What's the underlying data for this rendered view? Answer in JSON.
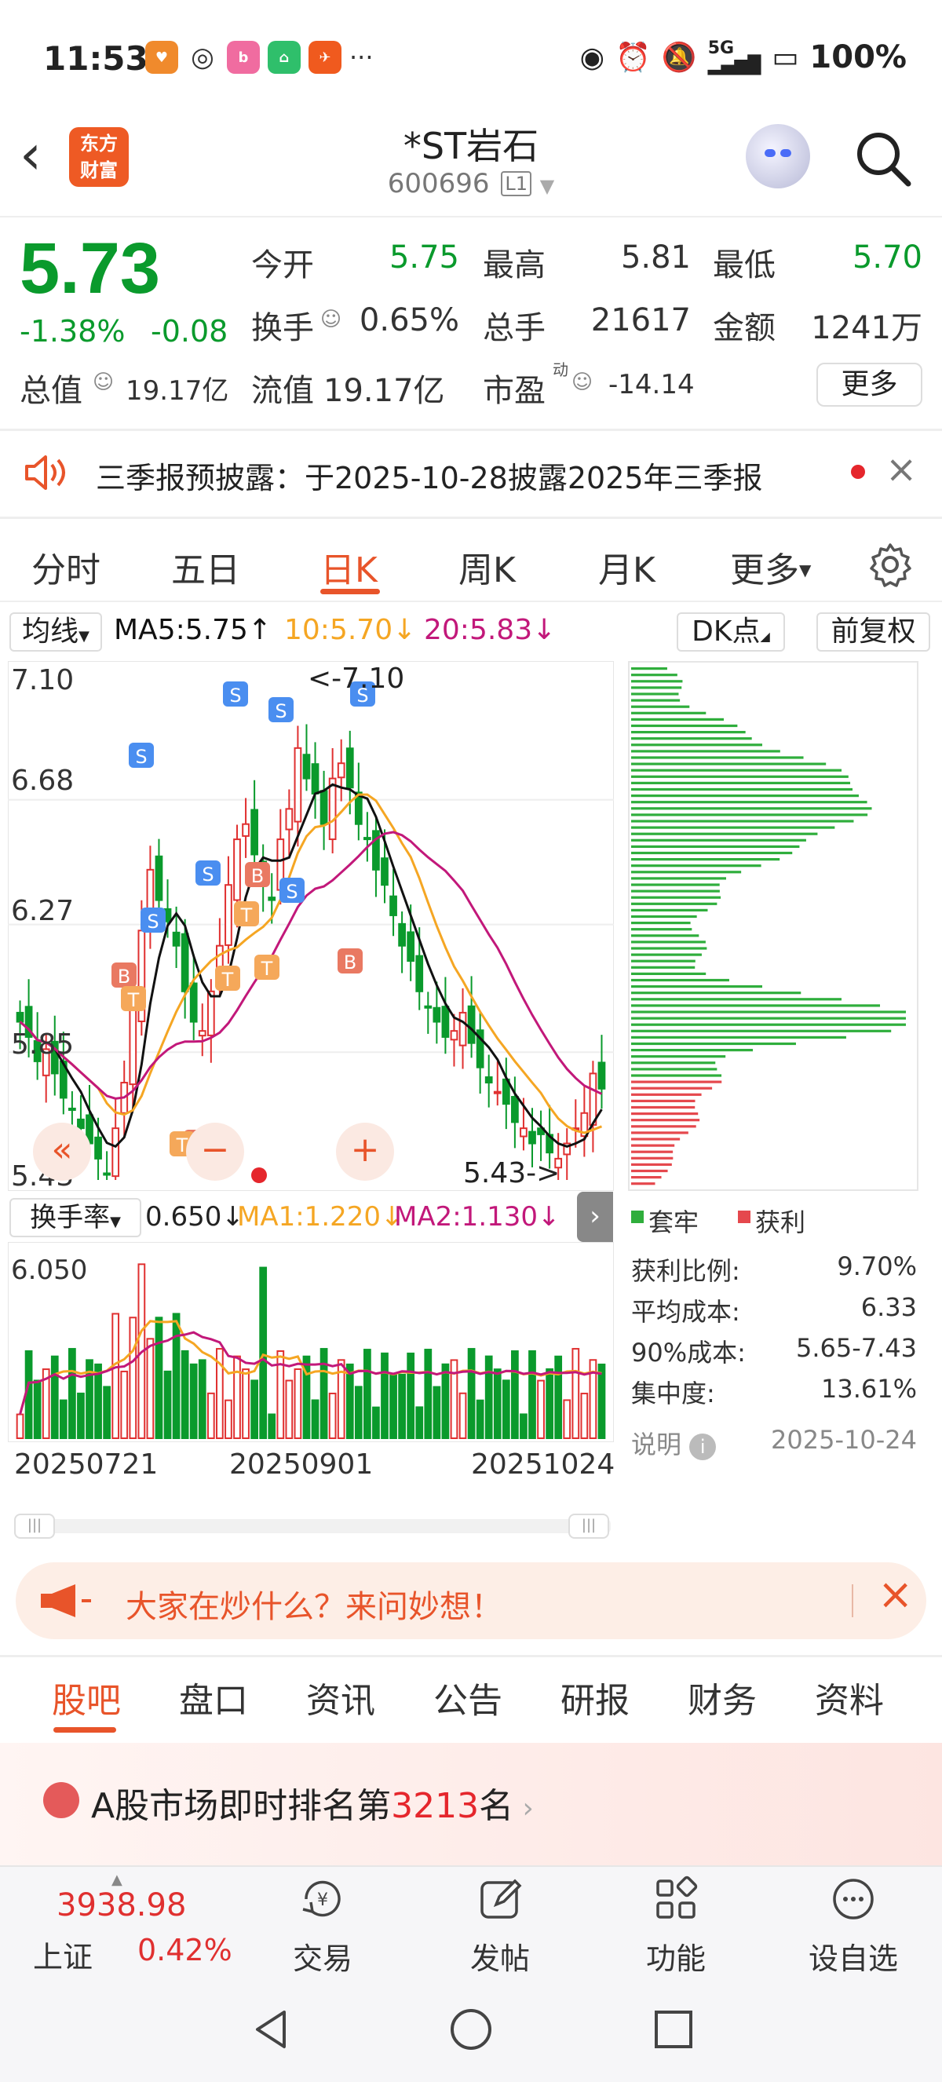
{
  "status_bar": {
    "time": "11:53",
    "battery": "100%",
    "signal": "5G"
  },
  "header": {
    "stock_name": "*ST岩石",
    "stock_code": "600696",
    "level_badge": "L1",
    "logo_line1": "东方",
    "logo_line2": "财富"
  },
  "quote": {
    "price": "5.73",
    "change_pct": "-1.38%",
    "change_abs": "-0.08",
    "open_label": "今开",
    "open": "5.75",
    "high_label": "最高",
    "high": "5.81",
    "low_label": "最低",
    "low": "5.70",
    "turnover_label": "换手",
    "turnover": "0.65%",
    "volume_label": "总手",
    "volume": "21617",
    "amount_label": "金额",
    "amount": "1241万",
    "mktcap_label": "总值",
    "mktcap": "19.17亿",
    "float_label": "流值",
    "float_cap": "19.17亿",
    "pe_label": "市盈",
    "pe_sup": "动",
    "pe": "-14.14",
    "more_label": "更多"
  },
  "notice": {
    "text": "三季报预披露：于2025-10-28披露2025年三季报"
  },
  "period_tabs": [
    "分时",
    "五日",
    "日K",
    "周K",
    "月K",
    "更多"
  ],
  "period_active": "日K",
  "chart_controls": {
    "ma_select": "均线",
    "ma5": "MA5:5.75↑",
    "ma10": "10:5.70↓",
    "ma20": "20:5.83↓",
    "dk_label": "DK点",
    "adjust_label": "前复权"
  },
  "price_labels": {
    "y1": "7.10",
    "y2": "6.68",
    "y3": "6.27",
    "y4": "5.85",
    "y5": "5.43",
    "max_mark": "<-7.10",
    "min_mark": "5.43->"
  },
  "turnover_indicator": {
    "select": "换手率",
    "value": "0.650↓",
    "ma1": "MA1:1.220↓",
    "ma2": "MA2:1.130↓",
    "ymax": "6.050"
  },
  "dates": [
    "20250721",
    "20250901",
    "20251024"
  ],
  "chip_dist": {
    "legend_trapped": "套牢",
    "legend_profit": "获利",
    "stats": [
      {
        "label": "获利比例:",
        "value": "9.70%"
      },
      {
        "label": "平均成本:",
        "value": "6.33"
      },
      {
        "label": "90%成本:",
        "value": "5.65-7.43"
      },
      {
        "label": "集中度:",
        "value": "13.61%"
      }
    ],
    "note_label": "说明",
    "date": "2025-10-24"
  },
  "promo": {
    "text": "大家在炒什么？来问妙想！"
  },
  "bottom_tabs": [
    "股吧",
    "盘口",
    "资讯",
    "公告",
    "研报",
    "财务",
    "资料"
  ],
  "bottom_tab_active": "股吧",
  "rank": {
    "prefix": "A股市场即时排名第",
    "number": "3213",
    "suffix": "名"
  },
  "index": {
    "value": "3938.98",
    "name": "上证",
    "change": "0.42%"
  },
  "nav": [
    "交易",
    "发帖",
    "功能",
    "设自选"
  ],
  "colors": {
    "up": "#e03030",
    "down": "#0a9a2c",
    "accent": "#e8542a",
    "ma5": "#111111",
    "ma10": "#f5a623",
    "ma20": "#c2187a"
  }
}
